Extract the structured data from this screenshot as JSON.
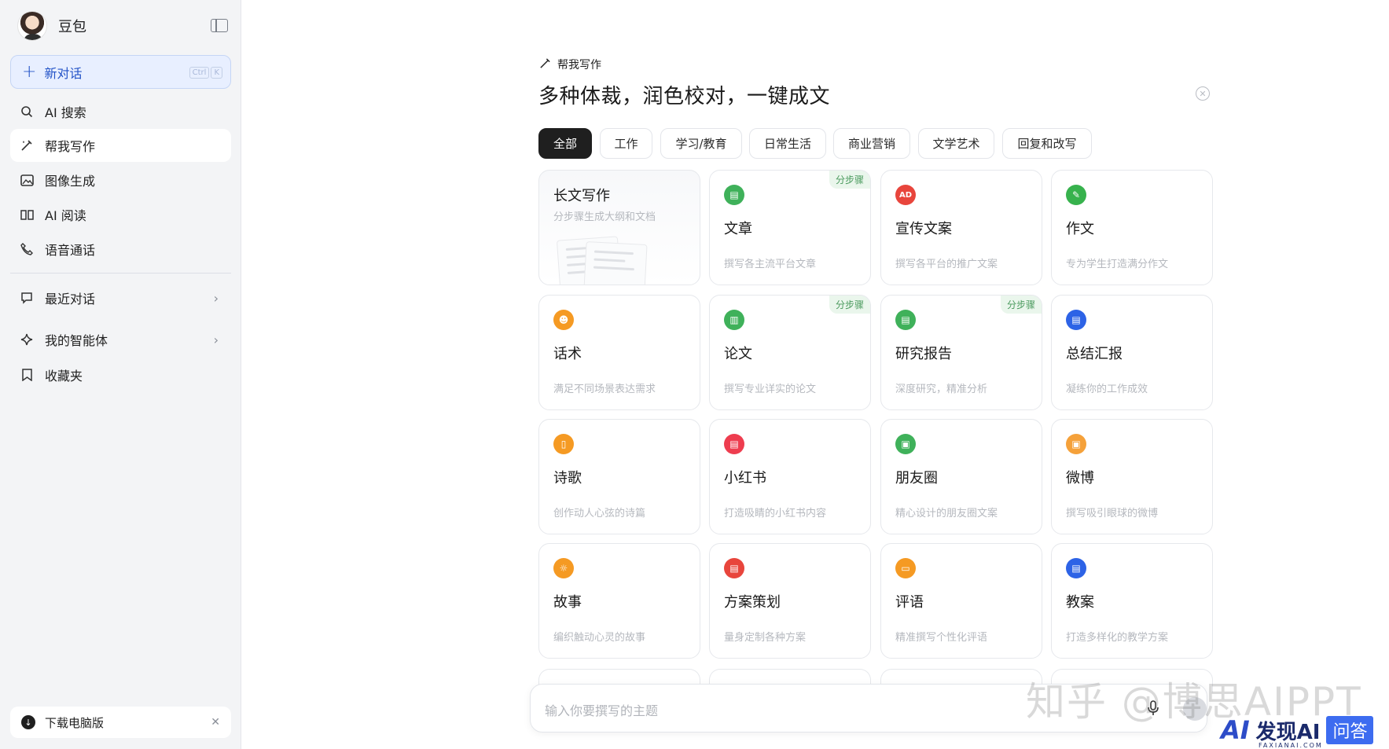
{
  "sidebar": {
    "brand_name": "豆包",
    "new_chat": {
      "label": "新对话",
      "shortcut": [
        "Ctrl",
        "K"
      ]
    },
    "items": [
      {
        "label": "AI 搜索",
        "icon": "search-icon"
      },
      {
        "label": "帮我写作",
        "icon": "pen-icon",
        "active": true
      },
      {
        "label": "图像生成",
        "icon": "image-icon"
      },
      {
        "label": "AI 阅读",
        "icon": "book-icon"
      },
      {
        "label": "语音通话",
        "icon": "phone-icon"
      }
    ],
    "sections": [
      {
        "label": "最近对话",
        "icon": "chat-icon"
      },
      {
        "label": "我的智能体",
        "icon": "sparkle-icon"
      },
      {
        "label": "收藏夹",
        "icon": "bookmark-icon"
      }
    ],
    "download": {
      "label": "下载电脑版"
    }
  },
  "main": {
    "header_label": "帮我写作",
    "headline": "多种体裁，润色校对，一键成文",
    "tabs": [
      "全部",
      "工作",
      "学习/教育",
      "日常生活",
      "商业营销",
      "文学艺术",
      "回复和改写"
    ],
    "badge_label": "分步骤",
    "cards": [
      {
        "title": "长文写作",
        "desc": "分步骤生成大纲和文档"
      },
      {
        "title": "文章",
        "desc": "撰写各主流平台文章",
        "badge": true,
        "color": "#3fb15a"
      },
      {
        "title": "宣传文案",
        "desc": "撰写各平台的推广文案",
        "icon_text": "AD",
        "color": "#e8453c"
      },
      {
        "title": "作文",
        "desc": "专为学生打造满分作文",
        "color": "#37b24d"
      },
      {
        "title": "话术",
        "desc": "满足不同场景表达需求",
        "color": "#f59a23"
      },
      {
        "title": "论文",
        "desc": "撰写专业详实的论文",
        "badge": true,
        "color": "#3fb15a"
      },
      {
        "title": "研究报告",
        "desc": "深度研究，精准分析",
        "badge": true,
        "color": "#3fb15a"
      },
      {
        "title": "总结汇报",
        "desc": "凝练你的工作成效",
        "color": "#2d63e6"
      },
      {
        "title": "诗歌",
        "desc": "创作动人心弦的诗篇",
        "color": "#f59a23"
      },
      {
        "title": "小红书",
        "desc": "打造吸睛的小红书内容",
        "color": "#ee3d4f"
      },
      {
        "title": "朋友圈",
        "desc": "精心设计的朋友圈文案",
        "color": "#3fb15a"
      },
      {
        "title": "微博",
        "desc": "撰写吸引眼球的微博",
        "color": "#f5a13a"
      },
      {
        "title": "故事",
        "desc": "编织触动心灵的故事",
        "color": "#f59a23"
      },
      {
        "title": "方案策划",
        "desc": "量身定制各种方案",
        "color": "#e8453c"
      },
      {
        "title": "评语",
        "desc": "精准撰写个性化评语",
        "color": "#f59a23"
      },
      {
        "title": "教案",
        "desc": "打造多样化的教学方案",
        "color": "#2d63e6"
      }
    ],
    "input": {
      "placeholder": "输入你要撰写的主题"
    }
  },
  "watermarks": {
    "zhihu": "知乎 @博思AIPPT",
    "brand_text": "发现AI",
    "brand_tag": "问答",
    "brand_url": "FAXIANAI.COM"
  }
}
